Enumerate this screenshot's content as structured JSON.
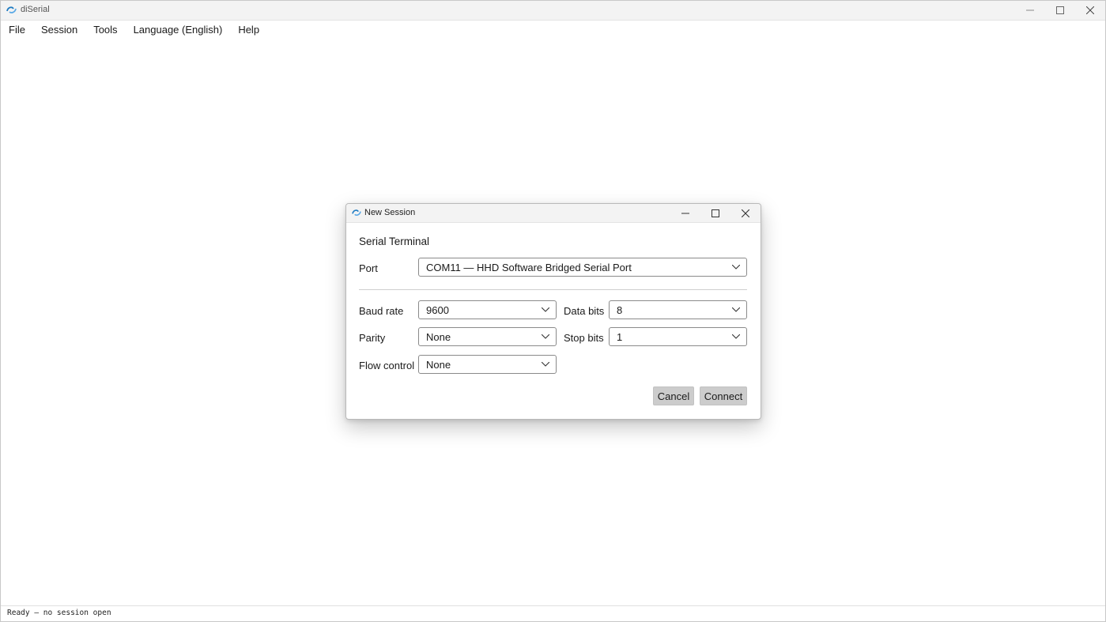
{
  "window": {
    "title": "diSerial",
    "icon": "diserial-logo-icon"
  },
  "menubar": {
    "items": [
      "File",
      "Session",
      "Tools",
      "Language (English)",
      "Help"
    ]
  },
  "dialog": {
    "title": "New Session",
    "section_title": "Serial Terminal",
    "port": {
      "label": "Port",
      "value": "COM11 — HHD Software Bridged Serial Port"
    },
    "baud_rate": {
      "label": "Baud rate",
      "value": "9600"
    },
    "data_bits": {
      "label": "Data bits",
      "value": "8"
    },
    "parity": {
      "label": "Parity",
      "value": "None"
    },
    "stop_bits": {
      "label": "Stop bits",
      "value": "1"
    },
    "flow_control": {
      "label": "Flow control",
      "value": "None"
    },
    "cancel_label": "Cancel",
    "connect_label": "Connect"
  },
  "statusbar": {
    "text": "Ready — no session open"
  },
  "colors": {
    "accent": "#1f7bc1",
    "button_bg": "#cccccc",
    "titlebar_bg": "#f3f3f3"
  }
}
